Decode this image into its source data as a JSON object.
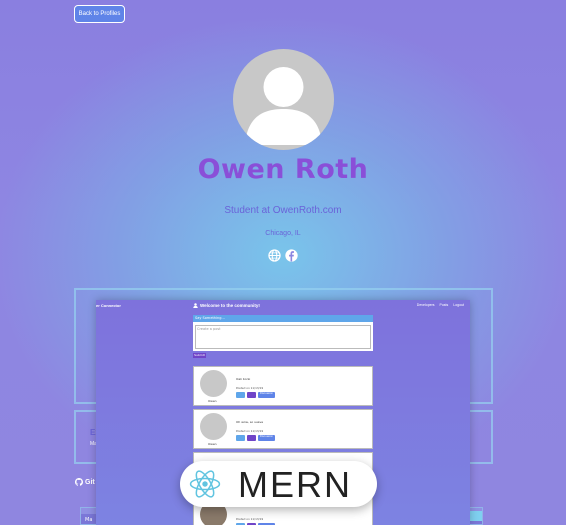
{
  "header": {
    "back_label": "Back to Profiles"
  },
  "profile": {
    "name": "Owen Roth",
    "status": "Student at OwenRoth.com",
    "location": "Chicago, IL",
    "socials": [
      "globe-icon",
      "facebook-icon"
    ]
  },
  "experience": {
    "title_fragment": "Ex",
    "sub_fragment": "Ma"
  },
  "github": {
    "label": "Git"
  },
  "bottom_card": {
    "text": "Ma"
  },
  "preview": {
    "brand": "er Connector",
    "welcome": "Welcome to the community!",
    "links": [
      "Developers",
      "Posts",
      "Logout"
    ],
    "form_header": "Say Something...",
    "textarea_placeholder": "Create a post",
    "submit_label": "Submit",
    "posts": [
      {
        "name": "Owen",
        "text": "Oak bonk",
        "date": "Posted on 11/13/19",
        "discussion": "Discussion"
      },
      {
        "name": "Owen",
        "text": "Oh wow, so suave",
        "date": "Posted on 11/13/19",
        "discussion": "Discussion"
      },
      {
        "name": "",
        "text": "",
        "date": "",
        "discussion": ""
      },
      {
        "name": "",
        "text": "",
        "date": "Posted on 11/13/19",
        "discussion": ""
      }
    ]
  },
  "badge": {
    "label": "MERN",
    "icon": "react-icon"
  },
  "colors": {
    "accent": "#8a4fd8",
    "button": "#5f84e8",
    "status_text": "#6a63d8"
  }
}
